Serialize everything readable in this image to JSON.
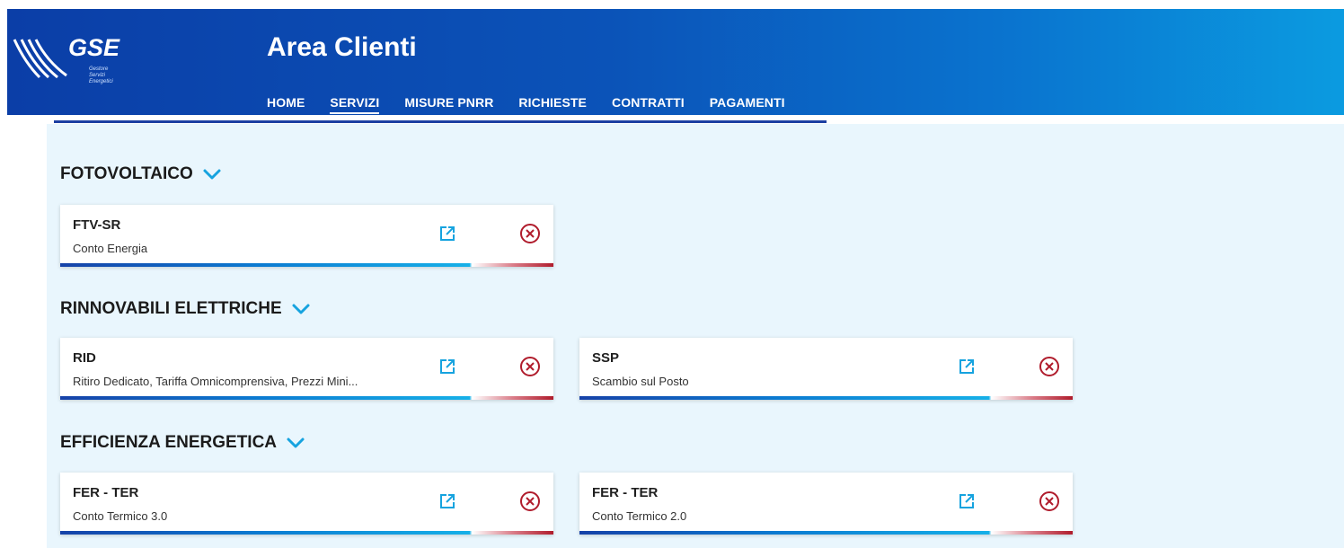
{
  "brand": {
    "logo_text": "GSE",
    "logo_subtitle": [
      "Gestore",
      "Servizi",
      "Energetici"
    ],
    "app_title": "Area Clienti"
  },
  "nav": {
    "items": [
      {
        "label": "HOME",
        "active": false
      },
      {
        "label": "SERVIZI",
        "active": true
      },
      {
        "label": "MISURE PNRR",
        "active": false
      },
      {
        "label": "RICHIESTE",
        "active": false
      },
      {
        "label": "CONTRATTI",
        "active": false
      },
      {
        "label": "PAGAMENTI",
        "active": false
      }
    ]
  },
  "sections": [
    {
      "title": "FOTOVOLTAICO",
      "cards": [
        {
          "title": "FTV-SR",
          "subtitle": "Conto Energia"
        }
      ]
    },
    {
      "title": "RINNOVABILI ELETTRICHE",
      "cards": [
        {
          "title": "RID",
          "subtitle": "Ritiro Dedicato, Tariffa Omnicomprensiva, Prezzi Mini..."
        },
        {
          "title": "SSP",
          "subtitle": "Scambio sul Posto"
        }
      ]
    },
    {
      "title": "EFFICIENZA ENERGETICA",
      "cards": [
        {
          "title": "FER - TER",
          "subtitle": "Conto Termico 3.0"
        },
        {
          "title": "FER - TER",
          "subtitle": "Conto Termico 2.0"
        }
      ]
    }
  ],
  "icons": {
    "section_toggle": "chevron-down-icon",
    "card_open": "external-link-icon",
    "card_close": "close-circle-icon"
  },
  "colors": {
    "header_dark": "#0b3ea7",
    "header_light": "#0b9be0",
    "accent_blue": "#16a3df",
    "close_red": "#b01c2c",
    "content_bg": "#e9f6fd"
  }
}
